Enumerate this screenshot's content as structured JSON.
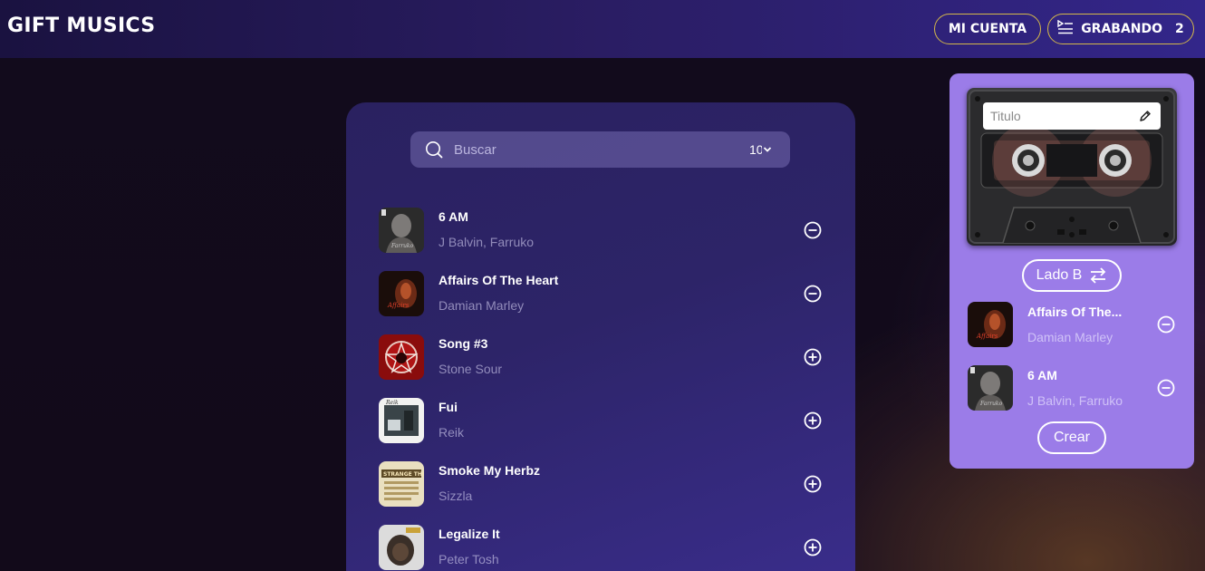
{
  "app": {
    "title": "GIFT MUSICS"
  },
  "header": {
    "account_label": "MI CUENTA",
    "recording_label": "GRABANDO",
    "recording_count": "2"
  },
  "search": {
    "placeholder": "Buscar",
    "page_size": "10"
  },
  "tracks": [
    {
      "title": "6 AM",
      "artist": "J Balvin,  Farruko",
      "action": "remove",
      "cover": "cover-6am"
    },
    {
      "title": "Affairs Of The Heart",
      "artist": "Damian Marley",
      "action": "remove",
      "cover": "cover-affairs"
    },
    {
      "title": "Song #3",
      "artist": "Stone Sour",
      "action": "add",
      "cover": "cover-song3"
    },
    {
      "title": "Fui",
      "artist": "Reik",
      "action": "add",
      "cover": "cover-fui"
    },
    {
      "title": "Smoke My Herbz",
      "artist": "Sizzla",
      "action": "add",
      "cover": "cover-smoke"
    },
    {
      "title": "Legalize It",
      "artist": "Peter Tosh",
      "action": "add",
      "cover": "cover-legalize"
    }
  ],
  "recorder": {
    "title_placeholder": "Titulo",
    "side_label": "Lado B",
    "create_label": "Crear",
    "tracks": [
      {
        "title": "Affairs Of The...",
        "artist": "Damian Marley",
        "cover": "cover-affairs"
      },
      {
        "title": "6 AM",
        "artist": "J Balvin,  Farruko",
        "cover": "cover-6am"
      }
    ]
  },
  "colors": {
    "accent_border": "#d4b84a",
    "recorder_panel": "#9b7ce8",
    "panel": "#2d2468"
  }
}
